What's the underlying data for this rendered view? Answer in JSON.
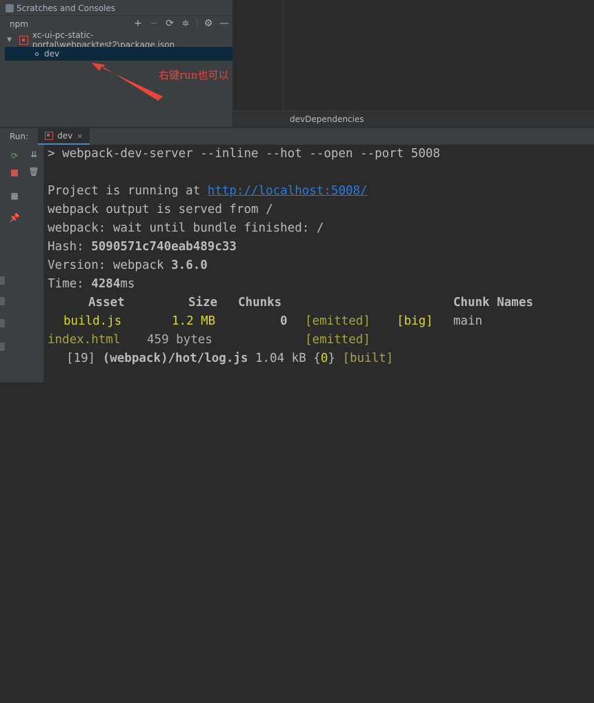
{
  "npm_panel": {
    "scratches_label": "Scratches and Consoles",
    "toolbar_label": "npm",
    "tools": [
      "add-icon",
      "remove-icon",
      "refresh-icon",
      "collapse-icon",
      "gear-icon",
      "minimize-icon"
    ],
    "root_item": "xc-ui-pc-static-portal\\webpacktest2\\package.json",
    "script_item": "dev"
  },
  "editor": {
    "bottom_label": "devDependencies"
  },
  "annotation": {
    "text": "右键run也可以",
    "color": "#e8453c"
  },
  "run_panel": {
    "label": "Run:",
    "tab_label": "dev",
    "close_glyph": "×"
  },
  "console": {
    "command": "> webpack-dev-server --inline --hot --open --port 5008",
    "running_prefix": "Project is running at ",
    "running_url": "http://localhost:5008/",
    "output_served": "webpack output is served from /",
    "wait_line": "webpack: wait until bundle finished: /",
    "hash_label": "Hash: ",
    "hash_value": "5090571c740eab489c33",
    "version_label": "Version: webpack ",
    "version_value": "3.6.0",
    "time_label": "Time: ",
    "time_value": "4284",
    "time_unit": "ms",
    "table_headers": {
      "asset": "Asset",
      "size": "Size",
      "chunks": "Chunks",
      "chunk_names": "Chunk Names"
    },
    "rows": [
      {
        "asset": "build.js",
        "size": "1.2 MB",
        "chunk": "0",
        "emitted": "[emitted]",
        "flag": "[big]",
        "name": "main"
      },
      {
        "asset": "index.html",
        "size": "459 bytes",
        "emitted": "[emitted]"
      }
    ],
    "module_line": {
      "id": "[19]",
      "path": "(webpack)/hot/log.js",
      "size": "1.04 kB",
      "chunk_open": "{",
      "chunk": "0",
      "chunk_close": "}",
      "status": "[built]"
    }
  }
}
